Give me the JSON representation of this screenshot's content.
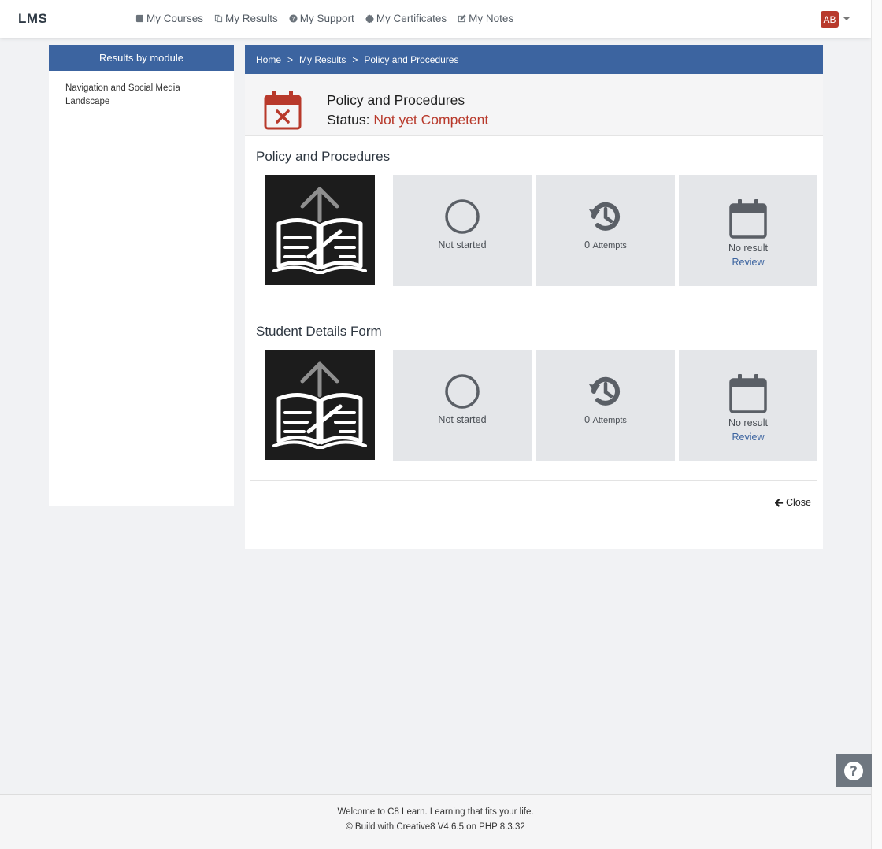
{
  "app": {
    "brand": "LMS"
  },
  "nav": [
    {
      "label": "My Courses",
      "icon": "book-icon"
    },
    {
      "label": "My Results",
      "icon": "copy-icon"
    },
    {
      "label": "My Support",
      "icon": "question-circle-icon"
    },
    {
      "label": "My Certificates",
      "icon": "certificate-icon"
    },
    {
      "label": "My Notes",
      "icon": "edit-icon"
    }
  ],
  "user": {
    "initials": "AB"
  },
  "sidebar": {
    "heading": "Results by module",
    "items": [
      {
        "label": "Navigation and Social Media Landscape"
      }
    ]
  },
  "breadcrumb": {
    "home": "Home",
    "sep": ">",
    "results": "My Results",
    "current": "Policy and Procedures"
  },
  "summary": {
    "title": "Policy and Procedures",
    "status_label": "Status:",
    "status_value": "Not yet Competent",
    "status_color": "#b8392b"
  },
  "sections": [
    {
      "title": "Policy and Procedures",
      "progress": "Not started",
      "attempts_count": "0",
      "attempts_label": "Attempts",
      "result": "No result",
      "review": "Review"
    },
    {
      "title": "Student Details Form",
      "progress": "Not started",
      "attempts_count": "0",
      "attempts_label": "Attempts",
      "result": "No result",
      "review": "Review"
    }
  ],
  "close_label": "Close",
  "footer": {
    "line1": "Welcome to C8 Learn. Learning that fits your life.",
    "line2": "© Build with Creative8 V4.6.5 on PHP 8.3.32"
  },
  "colors": {
    "primary": "#3c64a0",
    "danger": "#b8392b"
  }
}
